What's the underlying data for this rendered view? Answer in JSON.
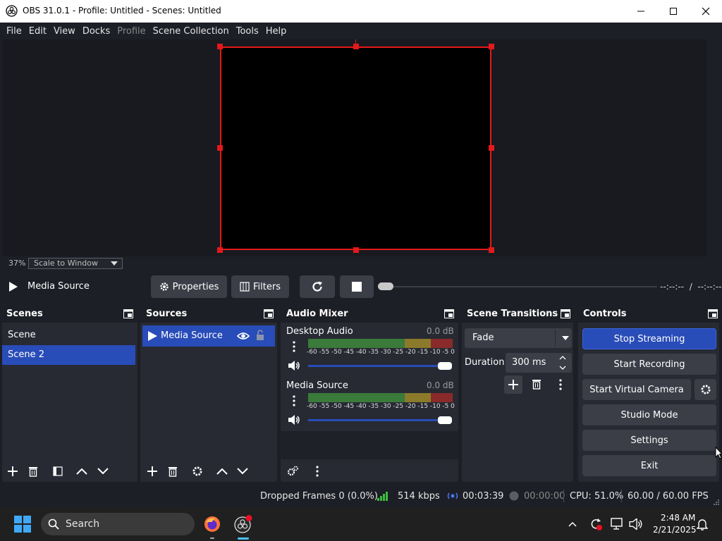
{
  "window": {
    "title": "OBS 31.0.1 - Profile: Untitled - Scenes: Untitled"
  },
  "menu": [
    "File",
    "Edit",
    "View",
    "Docks",
    "Profile",
    "Scene Collection",
    "Tools",
    "Help"
  ],
  "preview": {
    "zoom": "37%",
    "scale_mode": "Scale to Window"
  },
  "media_controls": {
    "source_name": "Media Source",
    "properties_label": "Properties",
    "filters_label": "Filters",
    "time_display": "--:--:--  /  --:--:--"
  },
  "scenes": {
    "title": "Scenes",
    "items": [
      "Scene",
      "Scene 2"
    ],
    "selected": "Scene 2"
  },
  "sources": {
    "title": "Sources",
    "items": [
      "Media Source"
    ]
  },
  "audio_mixer": {
    "title": "Audio Mixer",
    "channels": [
      {
        "name": "Desktop Audio",
        "level": "0.0 dB"
      },
      {
        "name": "Media Source",
        "level": "0.0 dB"
      }
    ],
    "meter_ticks": [
      "-60",
      "-55",
      "-50",
      "-45",
      "-40",
      "-35",
      "-30",
      "-25",
      "-20",
      "-15",
      "-10",
      "-5",
      "0"
    ]
  },
  "scene_transitions": {
    "title": "Scene Transitions",
    "transition": "Fade",
    "duration_label": "Duration",
    "duration_value": "300 ms"
  },
  "controls": {
    "title": "Controls",
    "stop_streaming": "Stop Streaming",
    "start_recording": "Start Recording",
    "start_virtual_camera": "Start Virtual Camera",
    "studio_mode": "Studio Mode",
    "settings": "Settings",
    "exit": "Exit"
  },
  "status": {
    "dropped_frames": "Dropped Frames 0 (0.0%)",
    "bitrate": "514 kbps",
    "stream_time": "00:03:39",
    "record_time": "00:00:00",
    "cpu": "CPU: 51.0%",
    "fps": "60.00 / 60.00 FPS"
  },
  "taskbar": {
    "search_label": "Search",
    "time": "2:48 AM",
    "date": "2/21/2025"
  },
  "colors": {
    "accent": "#284cb8",
    "selection_border": "#e3191a",
    "background": "#1d1f26",
    "panel": "#272a33"
  }
}
